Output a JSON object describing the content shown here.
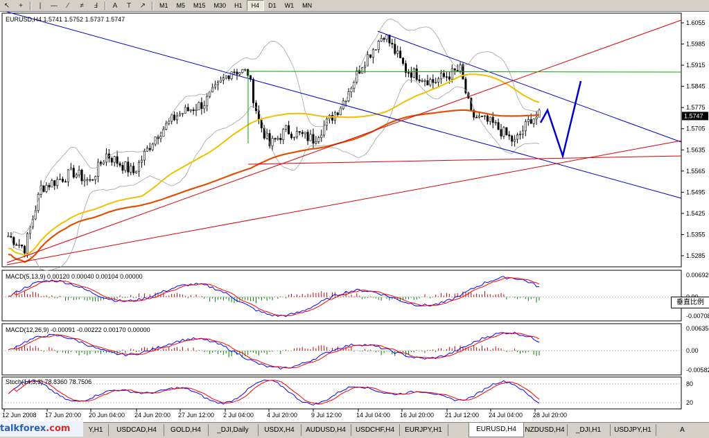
{
  "toolbar": {
    "timeframes": [
      "M1",
      "M5",
      "M15",
      "M30",
      "H1",
      "H4",
      "D1",
      "W1",
      "MN"
    ],
    "active_timeframe": "H4",
    "drawing_tools": [
      "cursor-arrow-icon",
      "crosshair-icon",
      "vertical-line-icon",
      "horizontal-line-icon",
      "trendline-icon",
      "channel-icon",
      "fibonacci-icon",
      "text-icon",
      "label-icon",
      "arrow-marker-icon"
    ],
    "tool_glyphs": [
      "↖",
      "+",
      "|",
      "—",
      "∕",
      "≠",
      "Ⅎ",
      "A",
      "T",
      "↗"
    ]
  },
  "main": {
    "title": "EURUSD,H4  1.5741 1.5752 1.5737 1.5747",
    "price_labels": [
      "1.6055",
      "1.5985",
      "1.5915",
      "1.5845",
      "1.5775",
      "1.5705",
      "1.5635",
      "1.5565",
      "1.5495",
      "1.5425",
      "1.5355",
      "1.5285"
    ],
    "current_price": "1.5747",
    "price_min": 1.5285,
    "price_max": 1.6055
  },
  "macd1": {
    "title": "MACD(5,13,9) 0.00120 0.00040 0.00104 0.00000",
    "labels": [
      "0.00692",
      "0.00",
      "-0.00708"
    ],
    "zoom_button": "垂直比例"
  },
  "macd2": {
    "title": "MACD(12,26,9) -0.00091 -0.00222 0.00170 0.00000",
    "labels": [
      "0.00635",
      "0.00",
      "-0.00582"
    ]
  },
  "stoch": {
    "title": "Stoch(14,3,3) 78.8360 78.7506",
    "labels": [
      "80",
      "20"
    ]
  },
  "time_axis": [
    "12 Jun 2008",
    "17 Jun 20:00",
    "20 Jun 04:00",
    "24 Jun 20:00",
    "27 Jun 12:00",
    "2 Jul 04:00",
    "4 Jul 20:00",
    "9 Jul 12:00",
    "14 Jul 04:00",
    "16 Jul 20:00",
    "21 Jul 12:00",
    "24 Jul 04:00",
    "28 Jul 20:00"
  ],
  "tabs": [
    "Y,H1",
    "USDCAD,H4",
    "GOLD,H4",
    "_DJI,Daily",
    "USDX,H4",
    "AUDUSD,H4",
    "USDCHF,H4",
    "EURJPY,H1",
    "EURUSD,H4",
    "NZDUSD,H4",
    "_DJI,H1",
    "USDJPY,H1",
    "A"
  ],
  "active_tab": "EURUSD,H4",
  "logo": {
    "text1": "talkforex",
    "text2": ".com"
  },
  "colors": {
    "chart_bg": "#ffffff",
    "channel": "#0000cc",
    "trendline": "#dd0000",
    "horizontal": "#00aa00",
    "ma_fast": "#f0c000",
    "ma_slow": "#e05000",
    "bollinger": "#a0a0a0",
    "macd_line": "#0000ff",
    "signal_line": "#ff0000",
    "hist_pos": "#cc0000",
    "hist_neg": "#008000"
  }
}
